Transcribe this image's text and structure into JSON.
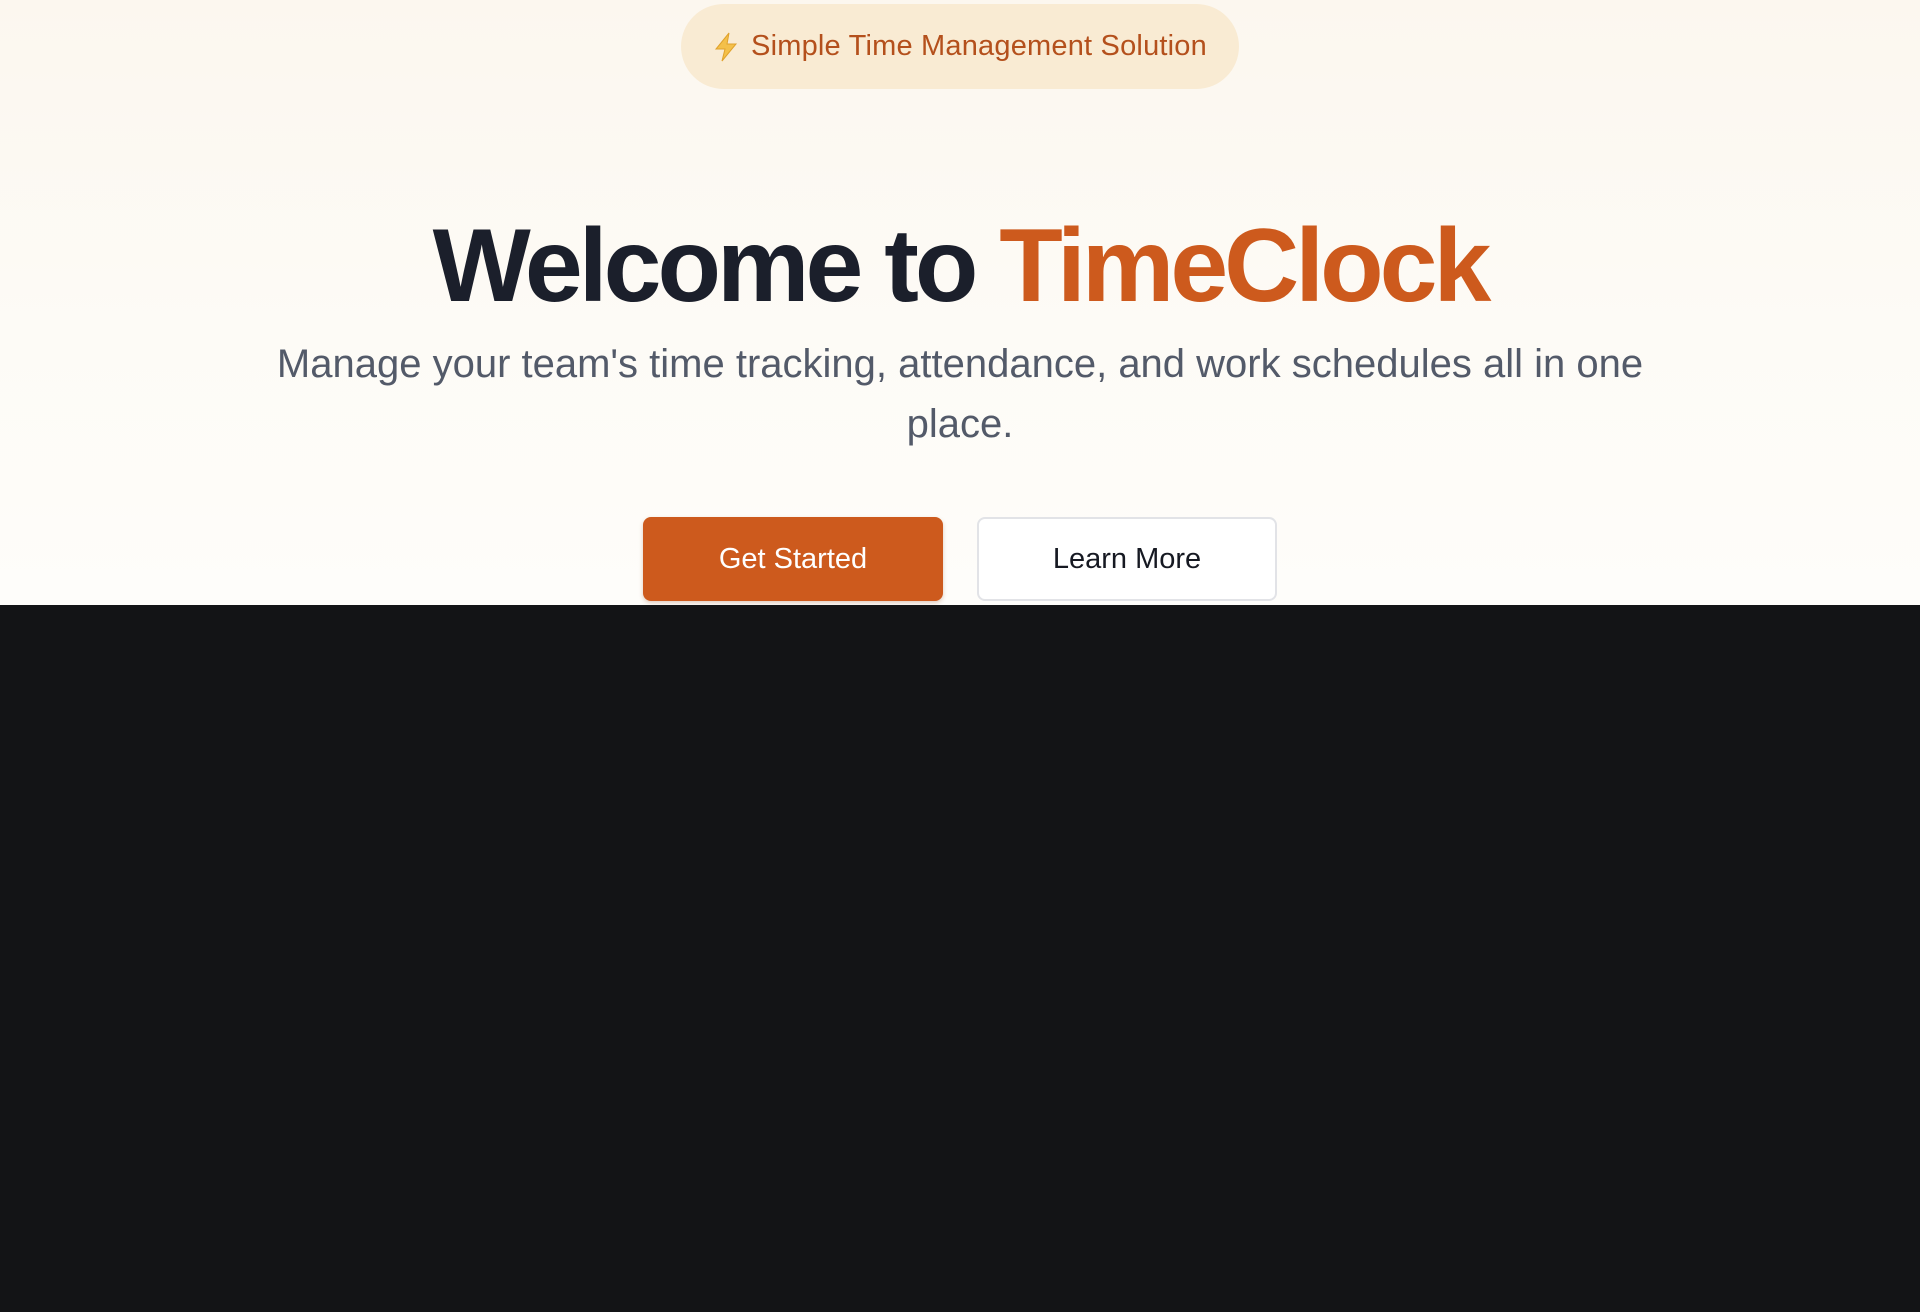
{
  "hero": {
    "badge": {
      "icon": "lightning-bolt-icon",
      "text": "Simple Time Management Solution"
    },
    "headline_prefix": "Welcome to",
    "headline_brand": "TimeClock",
    "subtitle": "Manage your team's time tracking, attendance, and work schedules all in one place.",
    "primary_button": "Get Started",
    "secondary_button": "Learn More"
  },
  "colors": {
    "accent": "#cd5a1d",
    "badge_background": "#f9ebd3",
    "badge_text": "#b4501c",
    "heading": "#1b1f2b",
    "subtitle": "#535a69",
    "dark_section": "#131416"
  }
}
